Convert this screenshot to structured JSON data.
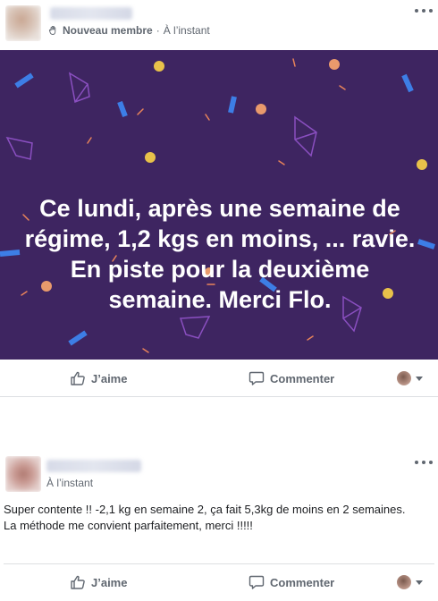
{
  "post1": {
    "author_name": "",
    "badge": "Nouveau membre",
    "time": "À l’instant",
    "banner_text": "Ce lundi, après une semaine de régime, 1,2 kgs en moins, ... ravie. En piste pour la deuxième semaine. Merci Flo.",
    "banner_color": "#3e2561",
    "actions": {
      "like": "J’aime",
      "comment": "Commenter"
    }
  },
  "post2": {
    "author_name": "",
    "time": "À l’instant",
    "text_line1": "Super contente !! -2,1 kg en semaine 2, ça fait 5,3kg de moins en 2 semaines.",
    "text_line2": "La méthode me convient parfaitement, merci !!!!!",
    "actions": {
      "like": "J’aime",
      "comment": "Commenter"
    }
  },
  "icons": [
    "wave-hand-icon",
    "more-options-icon",
    "like-thumb-icon",
    "comment-bubble-icon",
    "reaction-selector-caret-icon"
  ]
}
